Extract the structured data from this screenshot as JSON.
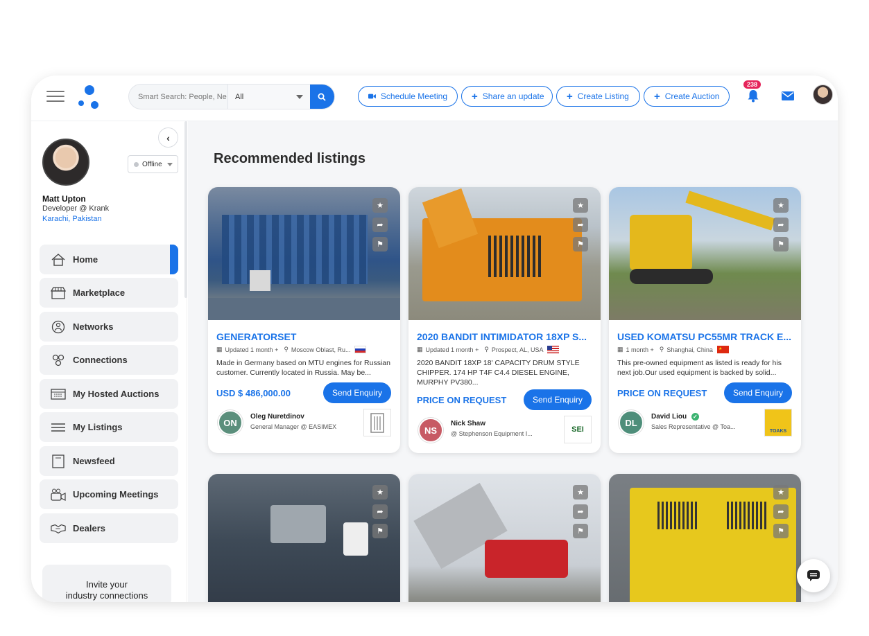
{
  "header": {
    "search_placeholder": "Smart Search: People, Ne",
    "search_scope": "All",
    "buttons": {
      "schedule_meeting": "Schedule Meeting",
      "share_update": "Share an update",
      "create_listing": "Create Listing",
      "create_auction": "Create Auction"
    },
    "notification_count": "238",
    "icons": [
      "menu-icon",
      "search-icon",
      "video-icon",
      "plus-icon",
      "bell-icon",
      "mail-icon"
    ]
  },
  "profile": {
    "name": "Matt Upton",
    "role": "Developer @ Krank",
    "location": "Karachi, Pakistan",
    "status": "Offline"
  },
  "sidebar": {
    "items": [
      {
        "label": "Home",
        "icon": "home-icon",
        "active": true
      },
      {
        "label": "Marketplace",
        "icon": "store-icon"
      },
      {
        "label": "Networks",
        "icon": "network-icon"
      },
      {
        "label": "Connections",
        "icon": "connections-icon"
      },
      {
        "label": "My Hosted Auctions",
        "icon": "auction-icon"
      },
      {
        "label": "My Listings",
        "icon": "list-icon"
      },
      {
        "label": "Newsfeed",
        "icon": "newsfeed-icon"
      },
      {
        "label": "Upcoming Meetings",
        "icon": "meeting-icon"
      },
      {
        "label": "Dealers",
        "icon": "handshake-icon"
      }
    ],
    "invite_line1": "Invite your",
    "invite_line2": "industry connections"
  },
  "main": {
    "heading": "Recommended listings",
    "enquiry_label": "Send Enquiry",
    "listings": [
      {
        "title": "GENERATORSET",
        "updated": "Updated 1 month +",
        "location": "Moscow Oblast, Ru...",
        "description": "Made in Germany based on MTU engines for Russian customer. Currently located in Russia. May be...",
        "price": "USD $ 486,000.00",
        "seller_initials": "ON",
        "seller_name": "Oleg Nuretdinov",
        "seller_role": "General Manager @ EASIMEX",
        "seller_color": "#5b8f7c"
      },
      {
        "title": "2020 BANDIT INTIMIDATOR 18XP S...",
        "updated": "Updated 1 month +",
        "location": "Prospect, AL, USA",
        "description": "2020 BANDIT 18XP 18' CAPACITY DRUM STYLE CHIPPER. 174 HP T4F C4.4 DIESEL ENGINE, MURPHY PV380...",
        "price": "PRICE ON REQUEST",
        "seller_initials": "NS",
        "seller_name": "Nick Shaw",
        "seller_role": "@ Stephenson Equipment I...",
        "seller_color": "#c75a64",
        "logo_text": "SEI"
      },
      {
        "title": "USED KOMATSU PC55MR TRACK E...",
        "updated": "1 month +",
        "location": "Shanghai, China",
        "description": "This pre-owned equipment as listed is ready for his next job.Our used equipment is backed by solid...",
        "price": "PRICE ON REQUEST",
        "seller_initials": "DL",
        "seller_name": "David Liou",
        "seller_role": "Sales Representative @ Toa...",
        "seller_color": "#4e8e7a",
        "logo_text": "TOAKS"
      }
    ]
  },
  "colors": {
    "accent": "#1a73e8",
    "badge": "#e5245a",
    "verified": "#3cb371"
  }
}
